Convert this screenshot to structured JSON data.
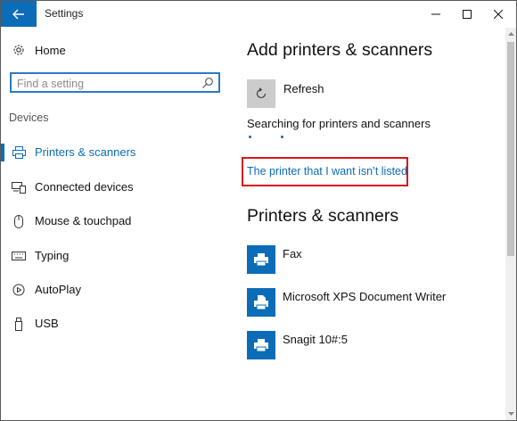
{
  "window": {
    "title": "Settings"
  },
  "sidebar": {
    "home_label": "Home",
    "search_placeholder": "Find a setting",
    "section_heading": "Devices",
    "items": [
      {
        "label": "Printers & scanners",
        "icon": "printer-icon",
        "active": true
      },
      {
        "label": "Connected devices",
        "icon": "connected-devices-icon",
        "active": false
      },
      {
        "label": "Mouse & touchpad",
        "icon": "mouse-icon",
        "active": false
      },
      {
        "label": "Typing",
        "icon": "keyboard-icon",
        "active": false
      },
      {
        "label": "AutoPlay",
        "icon": "autoplay-icon",
        "active": false
      },
      {
        "label": "USB",
        "icon": "usb-icon",
        "active": false
      }
    ]
  },
  "main": {
    "add_heading": "Add printers & scanners",
    "refresh_label": "Refresh",
    "searching_text": "Searching for printers and scanners",
    "not_listed_link": "The printer that I want isn’t listed",
    "list_heading": "Printers & scanners",
    "printers": [
      {
        "label": "Fax"
      },
      {
        "label": "Microsoft XPS Document Writer"
      },
      {
        "label": "Snagit 10#:5"
      }
    ]
  },
  "colors": {
    "accent": "#0b6cb8",
    "highlight_box": "#d9151e"
  }
}
